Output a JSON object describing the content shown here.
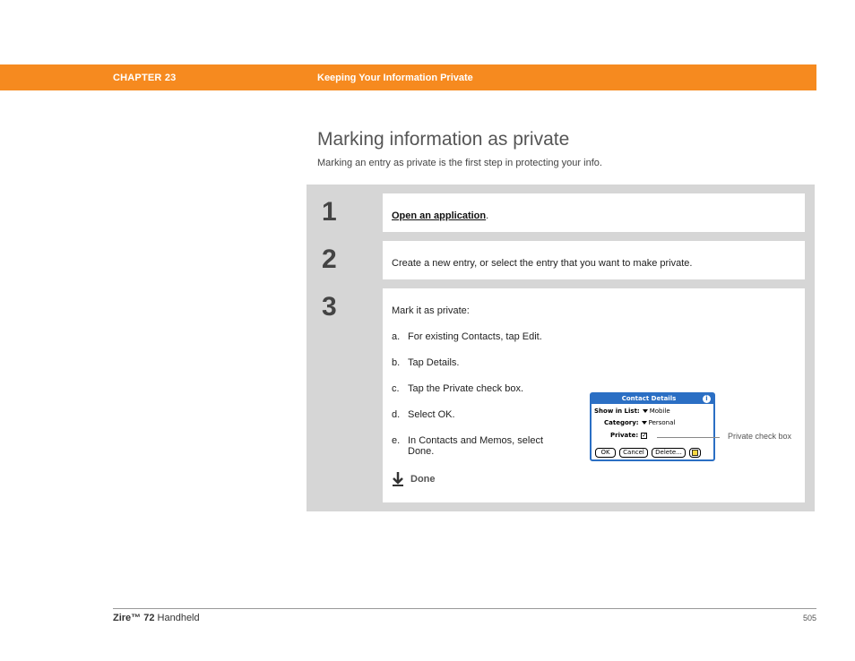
{
  "header": {
    "chapter": "CHAPTER 23",
    "title": "Keeping Your Information Private",
    "bar_color": "#f68a1f"
  },
  "section": {
    "title": "Marking information as private",
    "intro": "Marking an entry as private is the first step in protecting your info."
  },
  "steps": [
    {
      "number": "1",
      "link_text": "Open an application",
      "suffix": "."
    },
    {
      "number": "2",
      "text": "Create a new entry, or select the entry that you want to make private."
    },
    {
      "number": "3",
      "text": "Mark it as private:",
      "sub_steps": [
        {
          "letter": "a.",
          "text": "For existing Contacts, tap Edit."
        },
        {
          "letter": "b.",
          "text": "Tap Details."
        },
        {
          "letter": "c.",
          "text": "Tap the Private check box."
        },
        {
          "letter": "d.",
          "text": "Select OK."
        },
        {
          "letter": "e.",
          "text": "In Contacts and Memos, select",
          "text2": "Done."
        }
      ],
      "done_label": "Done"
    }
  ],
  "dialog": {
    "title": "Contact Details",
    "info_icon": "i",
    "show_in_list_label": "Show in List:",
    "show_in_list_value": "Mobile",
    "category_label": "Category:",
    "category_value": "Personal",
    "private_label": "Private:",
    "buttons": [
      "OK",
      "Cancel",
      "Delete..."
    ],
    "accent_color": "#2b6fc4",
    "callout": "Private check box"
  },
  "footer": {
    "product_bold": "Zire™ 72",
    "product_rest": " Handheld",
    "page_number": "505"
  }
}
